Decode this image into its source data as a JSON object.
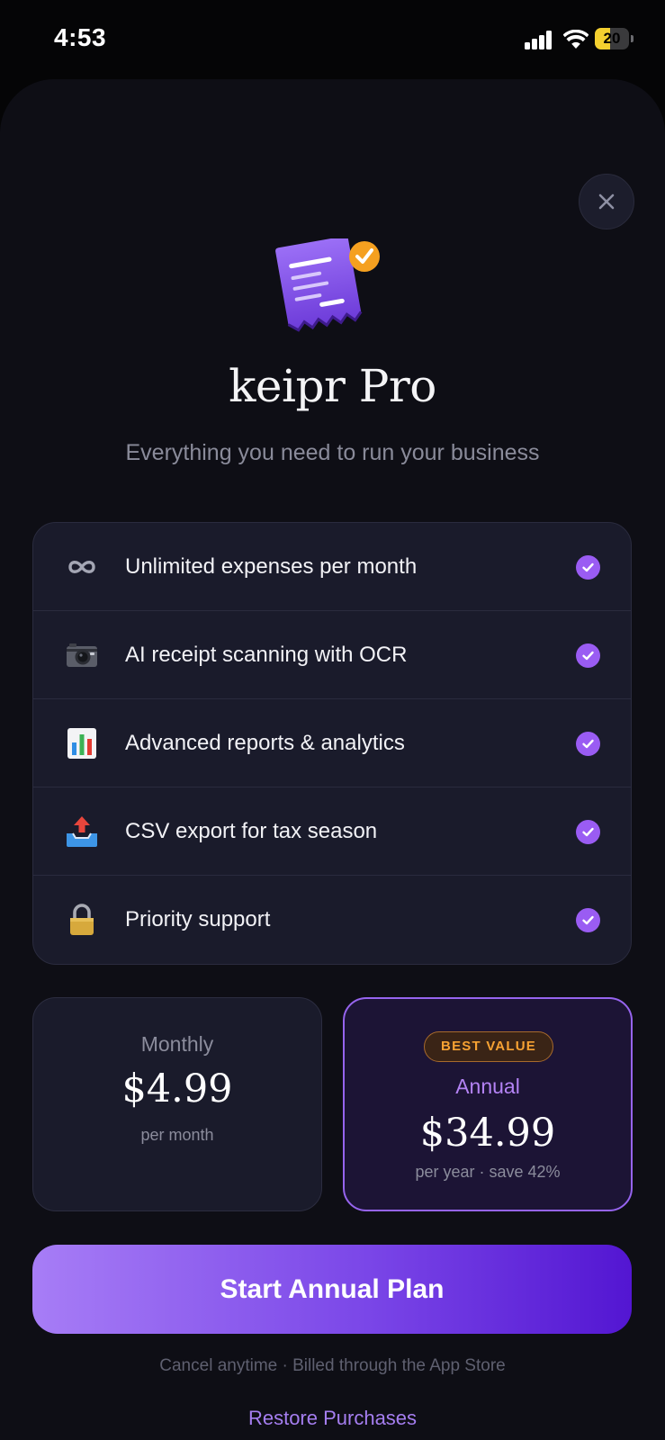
{
  "status_bar": {
    "time": "4:53",
    "battery_level": "20",
    "battery_fraction": 0.2
  },
  "paywall": {
    "app_name": "keipr Pro",
    "tagline": "Everything you need to run your business",
    "features": [
      {
        "icon": "infinity-icon",
        "label": "Unlimited expenses per month"
      },
      {
        "icon": "camera-icon",
        "label": "AI receipt scanning with OCR"
      },
      {
        "icon": "bar-chart-icon",
        "label": "Advanced reports & analytics"
      },
      {
        "icon": "outbox-tray-icon",
        "label": "CSV export for tax season"
      },
      {
        "icon": "lock-icon",
        "label": "Priority support"
      }
    ],
    "plans": {
      "monthly": {
        "name": "Monthly",
        "price": "$4.99",
        "period": "per month"
      },
      "annual": {
        "badge": "BEST VALUE",
        "name": "Annual",
        "price": "$34.99",
        "period": "per year · save 42%"
      }
    },
    "cta_label": "Start Annual Plan",
    "fine_print": "Cancel anytime · Billed through the App Store",
    "restore_label": "Restore Purchases"
  },
  "colors": {
    "accent": "#9a5cf3",
    "cta_gradient_start": "#a77df6",
    "cta_gradient_end": "#5316d2",
    "badge_text": "#f7a233",
    "sheet_background": "#0e0e15"
  }
}
